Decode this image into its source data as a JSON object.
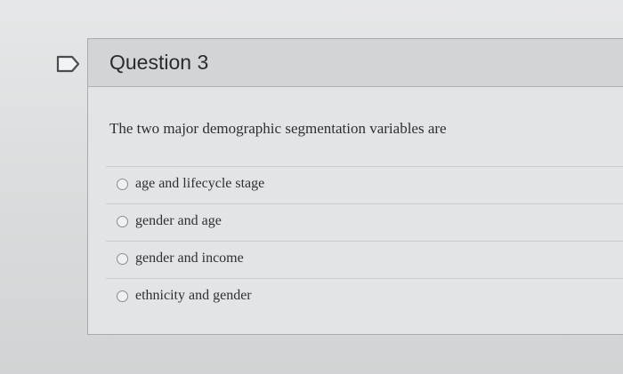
{
  "question": {
    "title": "Question 3",
    "text": "The two major demographic segmentation variables are",
    "flag_icon": "flag-outline-icon"
  },
  "answers": [
    {
      "label": "age and lifecycle stage"
    },
    {
      "label": "gender and age"
    },
    {
      "label": "gender and income"
    },
    {
      "label": "ethnicity and gender"
    }
  ],
  "colors": {
    "background": "#d8dadb",
    "header": "#d2d4d6",
    "text": "#2a2b2d",
    "radio_border": "#8a8d90"
  }
}
